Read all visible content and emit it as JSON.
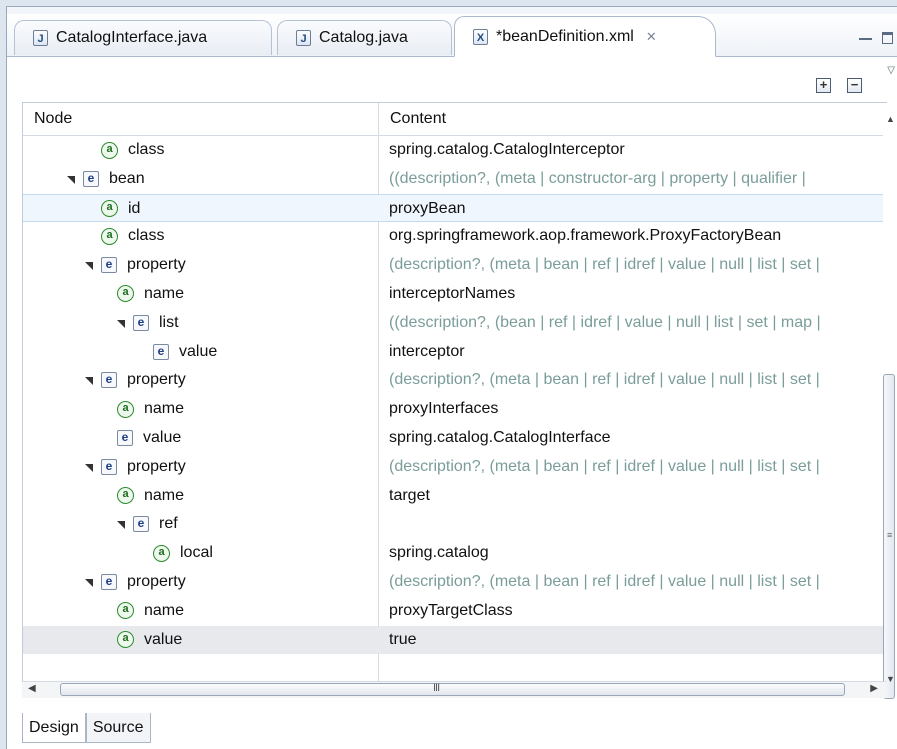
{
  "tabs": [
    {
      "label": "CatalogInterface.java",
      "icon": "J"
    },
    {
      "label": "Catalog.java",
      "icon": "J"
    },
    {
      "label": "*beanDefinition.xml",
      "icon": "X"
    }
  ],
  "toolbar": {
    "expand_symbol": "+",
    "collapse_symbol": "−"
  },
  "table": {
    "headers": {
      "node": "Node",
      "content": "Content"
    },
    "rows": [
      {
        "type": "a",
        "label": "class",
        "content": "spring.catalog.CatalogInterceptor",
        "hint": false
      },
      {
        "type": "e",
        "label": "bean",
        "content": "((description?, (meta | constructor-arg | property | qualifier |",
        "hint": true,
        "expanded": true
      },
      {
        "type": "a",
        "label": "id",
        "content": "proxyBean",
        "hint": false,
        "selected": true
      },
      {
        "type": "a",
        "label": "class",
        "content": "org.springframework.aop.framework.ProxyFactoryBean",
        "hint": false
      },
      {
        "type": "e",
        "label": "property",
        "content": "(description?, (meta | bean | ref | idref | value | null | list | set |",
        "hint": true,
        "expanded": true
      },
      {
        "type": "a",
        "label": "name",
        "content": "interceptorNames",
        "hint": false
      },
      {
        "type": "e",
        "label": "list",
        "content": "((description?, (bean | ref | idref | value | null | list | set | map |",
        "hint": true,
        "expanded": true
      },
      {
        "type": "e",
        "label": "value",
        "content": "interceptor",
        "hint": false
      },
      {
        "type": "e",
        "label": "property",
        "content": "(description?, (meta | bean | ref | idref | value | null | list | set |",
        "hint": true,
        "expanded": true
      },
      {
        "type": "a",
        "label": "name",
        "content": "proxyInterfaces",
        "hint": false
      },
      {
        "type": "e",
        "label": "value",
        "content": "spring.catalog.CatalogInterface",
        "hint": false
      },
      {
        "type": "e",
        "label": "property",
        "content": "(description?, (meta | bean | ref | idref | value | null | list | set |",
        "hint": true,
        "expanded": true
      },
      {
        "type": "a",
        "label": "name",
        "content": "target",
        "hint": false
      },
      {
        "type": "e",
        "label": "ref",
        "content": "",
        "hint": false,
        "expanded": true
      },
      {
        "type": "a",
        "label": "local",
        "content": "spring.catalog",
        "hint": false
      },
      {
        "type": "e",
        "label": "property",
        "content": "(description?, (meta | bean | ref | idref | value | null | list | set |",
        "hint": true,
        "expanded": true
      },
      {
        "type": "a",
        "label": "name",
        "content": "proxyTargetClass",
        "hint": false
      },
      {
        "type": "a",
        "label": "value",
        "content": "true",
        "hint": false,
        "last_selected": true
      },
      {
        "type": "blank",
        "label": "",
        "content": "",
        "hint": false
      }
    ]
  },
  "scroll_h_grip": "III",
  "bottom_tabs": [
    {
      "label": "Design",
      "active": true
    },
    {
      "label": "Source",
      "active": false
    }
  ]
}
